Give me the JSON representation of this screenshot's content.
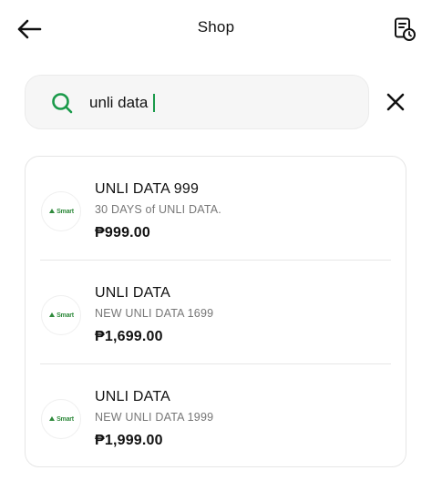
{
  "header": {
    "title": "Shop",
    "back_icon": "arrow-left-icon",
    "receipt_icon": "receipt-clock-icon"
  },
  "search": {
    "value": "unli data",
    "icon": "search-icon",
    "clear_icon": "close-icon",
    "accent_color": "#1a9a4a"
  },
  "results": {
    "items": [
      {
        "name": "UNLI DATA 999",
        "description": "30 DAYS of UNLI DATA.",
        "price": "₱999.00",
        "brand": "Smart"
      },
      {
        "name": "UNLI DATA",
        "description": "NEW UNLI DATA 1699",
        "price": "₱1,699.00",
        "brand": "Smart"
      },
      {
        "name": "UNLI DATA",
        "description": "NEW UNLI DATA 1999",
        "price": "₱1,999.00",
        "brand": "Smart"
      }
    ]
  }
}
